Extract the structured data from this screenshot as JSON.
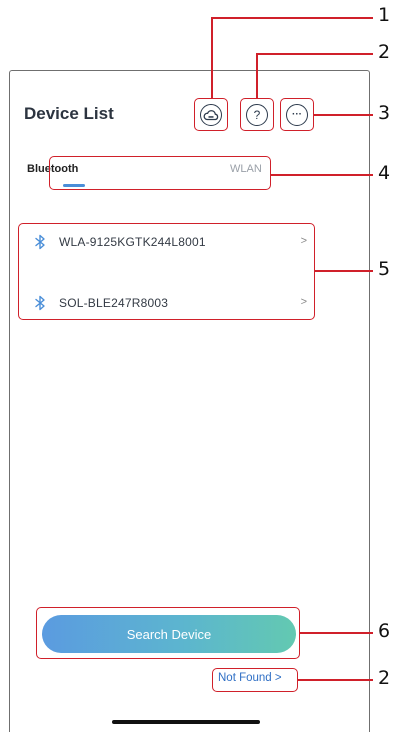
{
  "header": {
    "title": "Device List",
    "cloud_icon": "cloud-icon",
    "help_icon": "help-icon",
    "more_icon": "more-icon",
    "help_glyph": "?",
    "more_glyph": "···"
  },
  "tabs": [
    {
      "label": "Bluetooth",
      "active": true
    },
    {
      "label": "WLAN",
      "active": false
    }
  ],
  "devices": [
    {
      "name": "WLA-9125KGTK244L8001",
      "icon": "bluetooth-icon"
    },
    {
      "name": "SOL-BLE247R8003",
      "icon": "bluetooth-icon"
    }
  ],
  "chevron": ">",
  "search_button": "Search Device",
  "not_found_link": "Not Found >",
  "callouts": [
    "1",
    "2",
    "3",
    "4",
    "5",
    "6",
    "2"
  ],
  "colors": {
    "accent": "#4a8ed8",
    "highlight": "#d0202a",
    "gradient_start": "#5b9be0",
    "gradient_end": "#63c9b1"
  }
}
